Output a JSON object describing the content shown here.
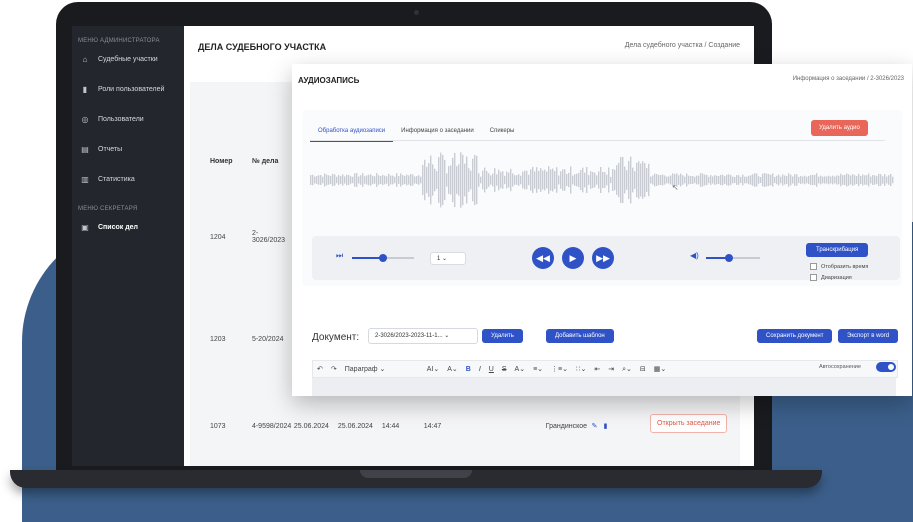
{
  "sidebar": {
    "section_admin": "МЕНЮ АДМИНИСТРАТОРА",
    "items": [
      {
        "label": "Судебные участки",
        "icon": "building-icon"
      },
      {
        "label": "Роли пользователей",
        "icon": "roles-icon"
      },
      {
        "label": "Пользователи",
        "icon": "user-icon"
      },
      {
        "label": "Отчеты",
        "icon": "report-icon"
      },
      {
        "label": "Статистика",
        "icon": "stats-icon"
      }
    ],
    "section_secretary": "МЕНЮ СЕКРЕТАРЯ",
    "active_item": {
      "label": "Список дел",
      "icon": "list-icon"
    }
  },
  "main": {
    "title": "ДЕЛА СУДЕБНОГО УЧАСТКА",
    "breadcrumb": "Дела судебного участка  /  Создание",
    "columns": [
      "Номер",
      "№ дела"
    ],
    "rows": [
      {
        "num": "1204",
        "case": "2-3026/2023"
      },
      {
        "num": "1203",
        "case": "5-20/2024"
      },
      {
        "num": "1073",
        "case": "4-9598/2024",
        "date1": "25.06.2024",
        "date2": "25.06.2024",
        "time1": "14:44",
        "time2": "14:47",
        "judge": "Грандинское",
        "open": "Открыть заседание"
      }
    ]
  },
  "audio": {
    "title": "АУДИОЗАПИСЬ",
    "breadcrumb": "Информация о заседании  /  2-3026/2023",
    "tabs": [
      "Обработка аудиозаписи",
      "Информация о заседании",
      "Спикеры"
    ],
    "delete_audio": "Удалить аудио",
    "speed": "1",
    "transcribe": "Транскрибация",
    "show_time": "Отобразить время",
    "diarization": "Диаризация",
    "document_label": "Документ:",
    "document_value": "2-3026/2023-2023-11-1...",
    "delete": "Удалить",
    "add_template": "Добавить шаблон",
    "save_doc": "Сохранить документ",
    "export_word": "Экспорт в word",
    "toolbar": {
      "paragraph": "Параграф",
      "autosave": "Автосохранение"
    }
  },
  "colors": {
    "accent": "#2f52c7",
    "danger": "#e8665a",
    "sidebar": "#23262d",
    "background_blob": "#3b5f8a"
  }
}
